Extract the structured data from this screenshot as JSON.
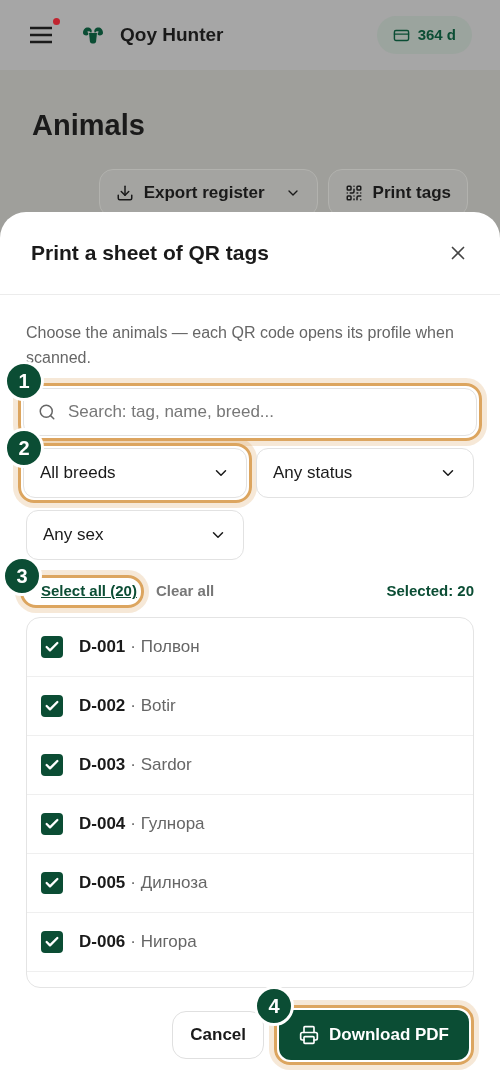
{
  "header": {
    "menu_badge": true,
    "app_name": "Qoy Hunter",
    "subscription": "364 d"
  },
  "page": {
    "title": "Animals",
    "actions": [
      {
        "kind": "export",
        "label": "Export register"
      },
      {
        "kind": "qr",
        "label": "Print tags"
      }
    ]
  },
  "dialog": {
    "title": "Print a sheet of QR tags",
    "description": "Choose the animals — each QR code opens its profile when scanned.",
    "search": {
      "placeholder": "Search: tag, name, breed...",
      "callout": "1"
    },
    "filters": [
      {
        "value": "All breeds",
        "callout": "2"
      },
      {
        "value": "Any status"
      },
      {
        "value": "Any sex"
      }
    ],
    "select_all": {
      "label": "Select all (20)",
      "callout": "3"
    },
    "clear_all": "Clear all",
    "selected_count": "Selected: 20",
    "animals": [
      {
        "tag": "D-001",
        "name": "· Полвон",
        "checked": true
      },
      {
        "tag": "D-002",
        "name": "· Botir",
        "checked": true
      },
      {
        "tag": "D-003",
        "name": "· Sardor",
        "checked": true
      },
      {
        "tag": "D-004",
        "name": "· Гулнора",
        "checked": true
      },
      {
        "tag": "D-005",
        "name": "· Дилноза",
        "checked": true
      },
      {
        "tag": "D-006",
        "name": "· Нигора",
        "checked": true
      }
    ],
    "cancel": "Cancel",
    "download": {
      "label": "Download PDF",
      "callout": "4"
    }
  }
}
